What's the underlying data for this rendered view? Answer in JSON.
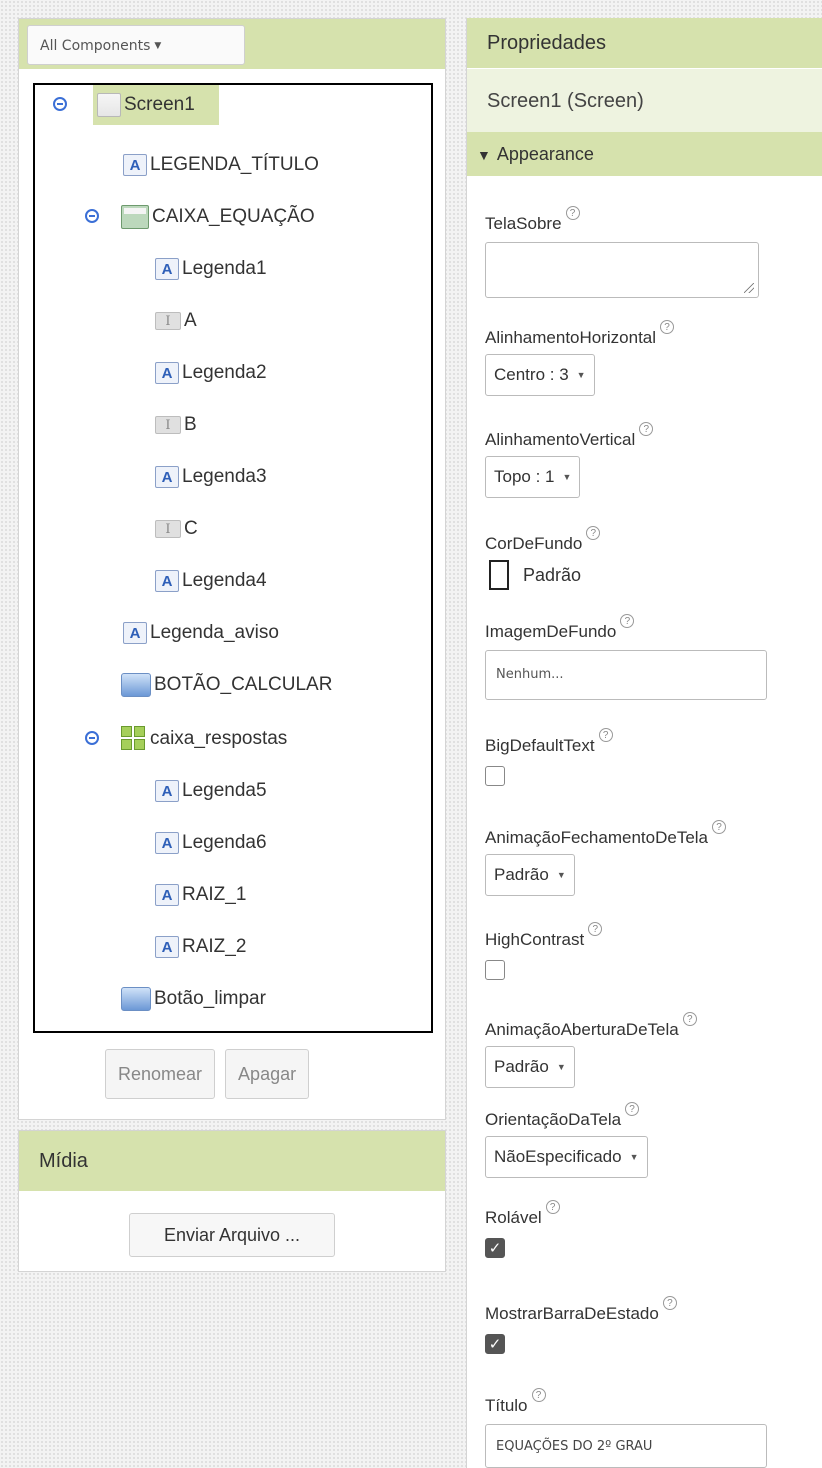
{
  "components": {
    "filter_label": "All Components",
    "tree": [
      {
        "name": "Screen1",
        "type": "screen",
        "expandable": true,
        "selected": true
      },
      {
        "name": "LEGENDA_TÍTULO",
        "type": "label"
      },
      {
        "name": "CAIXA_EQUAÇÃO",
        "type": "horizontal-arrangement",
        "expandable": true
      },
      {
        "name": "Legenda1",
        "type": "label"
      },
      {
        "name": "A",
        "type": "textbox"
      },
      {
        "name": "Legenda2",
        "type": "label"
      },
      {
        "name": "B",
        "type": "textbox"
      },
      {
        "name": "Legenda3",
        "type": "label"
      },
      {
        "name": "C",
        "type": "textbox"
      },
      {
        "name": "Legenda4",
        "type": "label"
      },
      {
        "name": "Legenda_aviso",
        "type": "label"
      },
      {
        "name": "BOTÃO_CALCULAR",
        "type": "button"
      },
      {
        "name": "caixa_respostas",
        "type": "table-arrangement",
        "expandable": true
      },
      {
        "name": "Legenda5",
        "type": "label"
      },
      {
        "name": "Legenda6",
        "type": "label"
      },
      {
        "name": "RAIZ_1",
        "type": "label"
      },
      {
        "name": "RAIZ_2",
        "type": "label"
      },
      {
        "name": "Botão_limpar",
        "type": "button"
      }
    ],
    "rename_label": "Renomear",
    "delete_label": "Apagar"
  },
  "media": {
    "title": "Mídia",
    "upload_label": "Enviar Arquivo ..."
  },
  "properties": {
    "title": "Propriedades",
    "component": "Screen1 (Screen)",
    "group": "Appearance",
    "help_glyph": "?",
    "items": {
      "about": {
        "name": "TelaSobre",
        "value": ""
      },
      "align_h": {
        "name": "AlinhamentoHorizontal",
        "value": "Centro : 3"
      },
      "align_v": {
        "name": "AlinhamentoVertical",
        "value": "Topo : 1"
      },
      "bg_color": {
        "name": "CorDeFundo",
        "value": "Padrão",
        "color": "#ffffff"
      },
      "bg_image": {
        "name": "ImagemDeFundo",
        "value": "Nenhum..."
      },
      "big_text": {
        "name": "BigDefaultText",
        "checked": false
      },
      "close_anim": {
        "name": "AnimaçãoFechamentoDeTela",
        "value": "Padrão"
      },
      "high_contrast": {
        "name": "HighContrast",
        "checked": false
      },
      "open_anim": {
        "name": "AnimaçãoAberturaDeTela",
        "value": "Padrão"
      },
      "orientation": {
        "name": "OrientaçãoDaTela",
        "value": "NãoEspecificado"
      },
      "scrollable": {
        "name": "Rolável",
        "checked": true
      },
      "status_bar": {
        "name": "MostrarBarraDeEstado",
        "checked": true
      },
      "title": {
        "name": "Título",
        "value": "EQUAÇÕES DO 2º GRAU"
      }
    }
  },
  "colors": {
    "header_green": "#d6e2ad",
    "toggle_blue": "#3b6fd6"
  }
}
